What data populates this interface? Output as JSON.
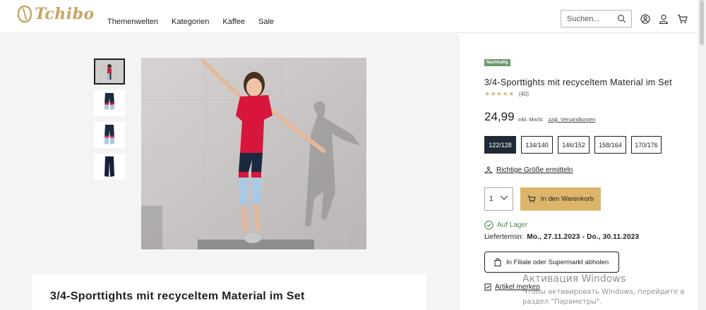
{
  "header": {
    "logo_text": "Tchibo",
    "nav": [
      "Themenwelten",
      "Kategorien",
      "Kaffee",
      "Sale"
    ],
    "search_placeholder": "Suchen..."
  },
  "product": {
    "badge": "Nachhaltig",
    "title": "3/4-Sporttights mit recyceltem Material im Set",
    "rating_stars": 5,
    "rating_count": "(40)",
    "price": "24,99",
    "tax_note": "inkl. MwSt.",
    "shipping_link": "zzgl. Versandkosten",
    "sizes": [
      "122/128",
      "134/140",
      "146/152",
      "158/164",
      "170/176"
    ],
    "selected_size": "122/128",
    "size_help": "Richtige Größe ermitteln",
    "quantity": "1",
    "add_to_cart": "In den Warenkorb",
    "stock": "Auf Lager",
    "delivery_label": "Liefertermin:",
    "delivery_dates": "Mo., 27.11.2023 - Do., 30.11.2023",
    "store_pickup": "In Filiale oder Supermarkt abholen",
    "wishlist": "Artikel merken"
  },
  "description": {
    "title": "3/4-Sporttights mit recyceltem Material im Set"
  },
  "watermark": {
    "line1": "Активация Windows",
    "line2": "Чтобы активировать Windows, перейдите в раздел \"Параметры\"."
  },
  "colors": {
    "accent_gold": "#dcb56b",
    "logo_gold": "#c9a463",
    "badge_green": "#6b9a6a",
    "stock_green": "#4f8b4f",
    "selected_size_bg": "#1f2a36"
  }
}
